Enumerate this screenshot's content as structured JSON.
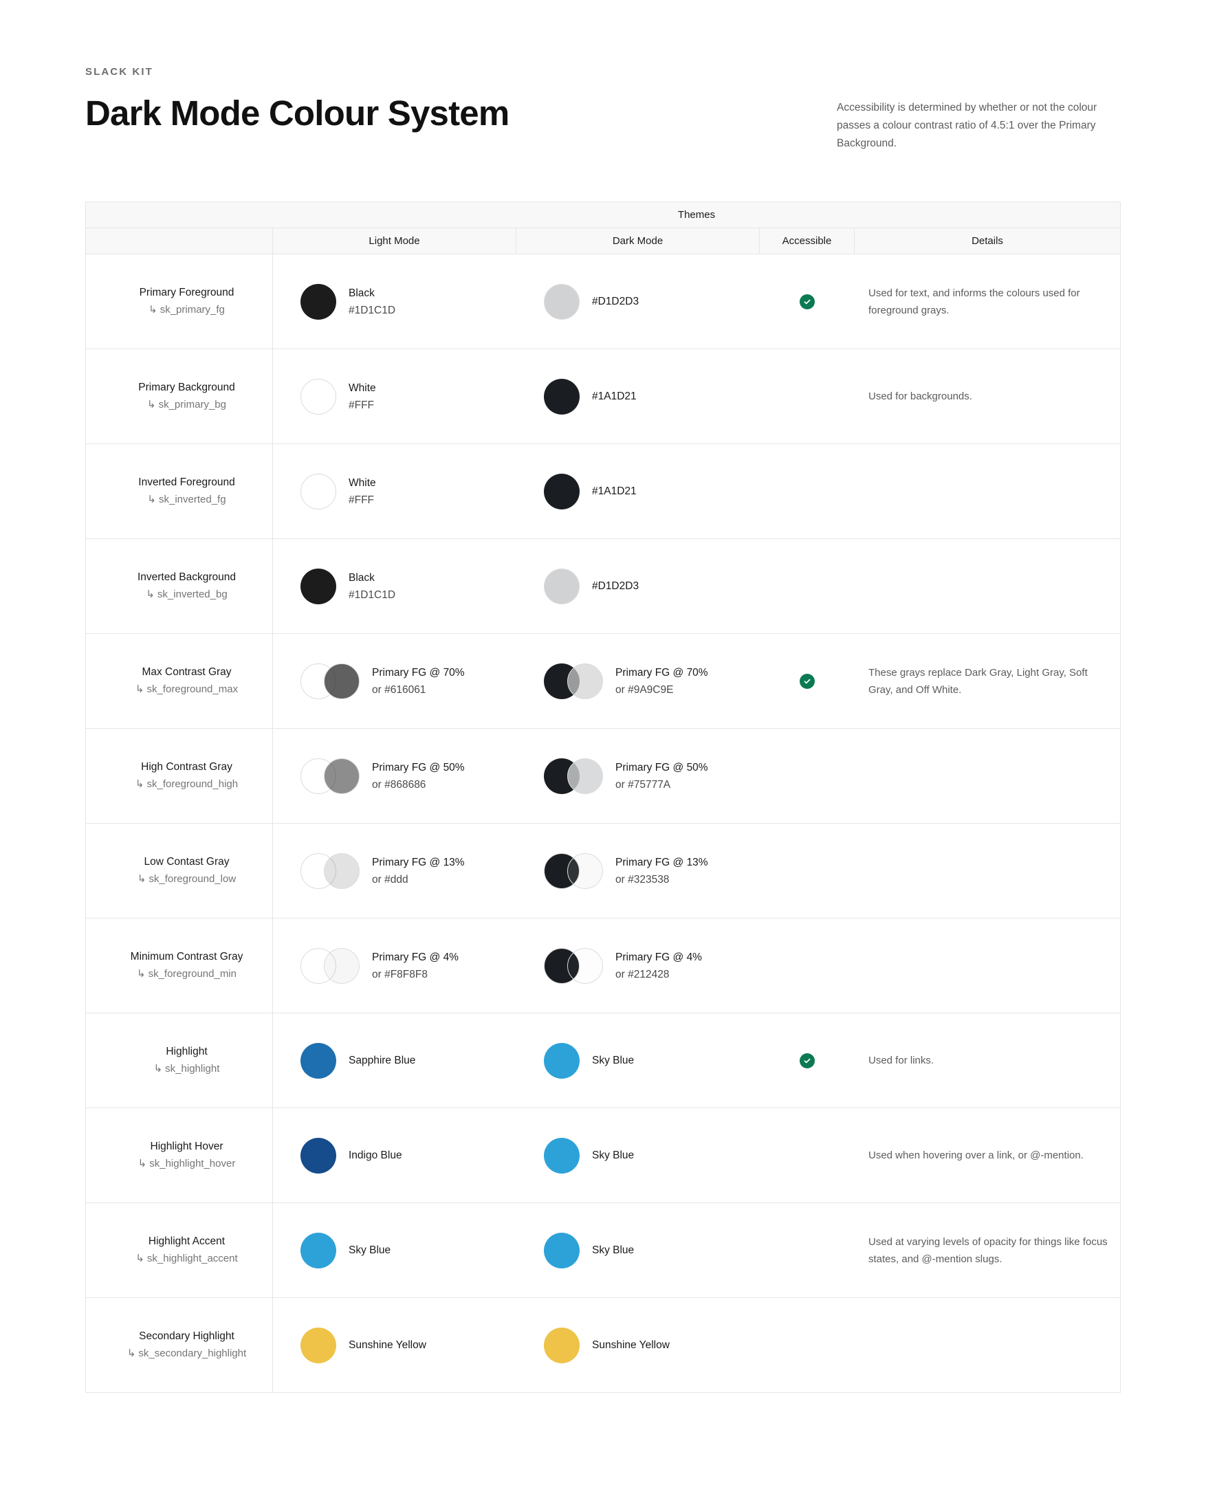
{
  "header": {
    "eyebrow": "SLACK KIT",
    "title": "Dark Mode Colour System",
    "intro": "Accessibility is determined by whether or not the colour passes a colour contrast ratio of 4.5:1 over the Primary Background."
  },
  "table": {
    "group_header": "Themes",
    "columns": {
      "name": "",
      "light": "Light Mode",
      "dark": "Dark Mode",
      "accessible": "Accessible",
      "details": "Details"
    }
  },
  "colors": {
    "black": "#1D1C1D",
    "white": "#FFFFFF",
    "dark_bg": "#1A1D21",
    "light_fg": "#D1D2D3",
    "sapphire_blue": "#1D6FB0",
    "indigo_blue": "#164B8C",
    "sky_blue": "#2DA2D8",
    "sunshine_yellow": "#EEC348",
    "accessible_green": "#0B7A53",
    "border": "#E6E6E6",
    "header_bg": "#F8F8F8"
  },
  "rows": [
    {
      "name": "Primary Foreground",
      "token": "sk_primary_fg",
      "light": {
        "line1": "Black",
        "line2": "#1D1C1D",
        "base": "#1D1C1D",
        "overlay": null,
        "base_ring": false
      },
      "dark": {
        "line1": "#D1D2D3",
        "line2": "",
        "base": "#D1D2D3",
        "overlay": null,
        "base_ring": true
      },
      "accessible": true,
      "details": "Used for text, and informs the colours used for foreground grays."
    },
    {
      "name": "Primary Background",
      "token": "sk_primary_bg",
      "light": {
        "line1": "White",
        "line2": "#FFF",
        "base": "#FFFFFF",
        "overlay": null,
        "base_ring": true
      },
      "dark": {
        "line1": "#1A1D21",
        "line2": "",
        "base": "#1A1D21",
        "overlay": null,
        "base_ring": false
      },
      "accessible": false,
      "details": "Used for backgrounds."
    },
    {
      "name": "Inverted Foreground",
      "token": "sk_inverted_fg",
      "light": {
        "line1": "White",
        "line2": "#FFF",
        "base": "#FFFFFF",
        "overlay": null,
        "base_ring": true
      },
      "dark": {
        "line1": "#1A1D21",
        "line2": "",
        "base": "#1A1D21",
        "overlay": null,
        "base_ring": false
      },
      "accessible": false,
      "details": ""
    },
    {
      "name": "Inverted Background",
      "token": "sk_inverted_bg",
      "light": {
        "line1": "Black",
        "line2": "#1D1C1D",
        "base": "#1D1C1D",
        "overlay": null,
        "base_ring": false
      },
      "dark": {
        "line1": "#D1D2D3",
        "line2": "",
        "base": "#D1D2D3",
        "overlay": null,
        "base_ring": true
      },
      "accessible": false,
      "details": ""
    },
    {
      "name": "Max Contrast Gray",
      "token": "sk_foreground_max",
      "light": {
        "line1": "Primary FG @ 70%",
        "line2": "or #616061",
        "base": "#FFFFFF",
        "overlay": "rgba(29,28,29,0.70)",
        "base_ring": true
      },
      "dark": {
        "line1": "Primary FG @ 70%",
        "line2": "or #9A9C9E",
        "base": "#1A1D21",
        "overlay": "rgba(209,210,211,0.70)",
        "base_ring": false
      },
      "accessible": true,
      "details": "These grays replace Dark Gray, Light Gray, Soft Gray, and Off White."
    },
    {
      "name": "High Contrast Gray",
      "token": "sk_foreground_high",
      "light": {
        "line1": "Primary FG @ 50%",
        "line2": "or #868686",
        "base": "#FFFFFF",
        "overlay": "rgba(29,28,29,0.50)",
        "base_ring": true
      },
      "dark": {
        "line1": "Primary FG @ 50%",
        "line2": "or #75777A",
        "base": "#1A1D21",
        "overlay": "rgba(209,210,211,0.80)",
        "base_ring": false
      },
      "accessible": false,
      "details": ""
    },
    {
      "name": "Low Contast Gray",
      "token": "sk_foreground_low",
      "light": {
        "line1": "Primary FG @ 13%",
        "line2": "or #ddd",
        "base": "#FFFFFF",
        "overlay": "rgba(29,28,29,0.13)",
        "base_ring": true
      },
      "dark": {
        "line1": "Primary FG @ 13%",
        "line2": "or #323538",
        "base": "#1A1D21",
        "overlay": "rgba(209,210,211,0.13)",
        "base_ring": true
      },
      "accessible": false,
      "details": ""
    },
    {
      "name": "Minimum Contrast Gray",
      "token": "sk_foreground_min",
      "light": {
        "line1": "Primary FG @ 4%",
        "line2": "or #F8F8F8",
        "base": "#FFFFFF",
        "overlay": "rgba(29,28,29,0.04)",
        "base_ring": true
      },
      "dark": {
        "line1": "Primary FG @ 4%",
        "line2": "or #212428",
        "base": "#1A1D21",
        "overlay": "rgba(209,210,211,0.04)",
        "base_ring": true
      },
      "accessible": false,
      "details": ""
    },
    {
      "name": "Highlight",
      "token": "sk_highlight",
      "light": {
        "line1": "Sapphire Blue",
        "line2": "",
        "base": "#1D6FB0",
        "overlay": null,
        "base_ring": false
      },
      "dark": {
        "line1": "Sky Blue",
        "line2": "",
        "base": "#2DA2D8",
        "overlay": null,
        "base_ring": false
      },
      "accessible": true,
      "details": "Used for links."
    },
    {
      "name": "Highlight Hover",
      "token": "sk_highlight_hover",
      "light": {
        "line1": "Indigo Blue",
        "line2": "",
        "base": "#164B8C",
        "overlay": null,
        "base_ring": false
      },
      "dark": {
        "line1": "Sky Blue",
        "line2": "",
        "base": "#2DA2D8",
        "overlay": null,
        "base_ring": false
      },
      "accessible": false,
      "details": "Used when hovering over a link, or @-mention."
    },
    {
      "name": "Highlight Accent",
      "token": "sk_highlight_accent",
      "light": {
        "line1": "Sky Blue",
        "line2": "",
        "base": "#2DA2D8",
        "overlay": null,
        "base_ring": false
      },
      "dark": {
        "line1": "Sky Blue",
        "line2": "",
        "base": "#2DA2D8",
        "overlay": null,
        "base_ring": false
      },
      "accessible": false,
      "details": "Used at varying levels of opacity for things like focus states, and @-mention slugs."
    },
    {
      "name": "Secondary Highlight",
      "token": "sk_secondary_highlight",
      "light": {
        "line1": "Sunshine Yellow",
        "line2": "",
        "base": "#EEC348",
        "overlay": null,
        "base_ring": false
      },
      "dark": {
        "line1": "Sunshine Yellow",
        "line2": "",
        "base": "#EEC348",
        "overlay": null,
        "base_ring": false
      },
      "accessible": false,
      "details": ""
    }
  ]
}
